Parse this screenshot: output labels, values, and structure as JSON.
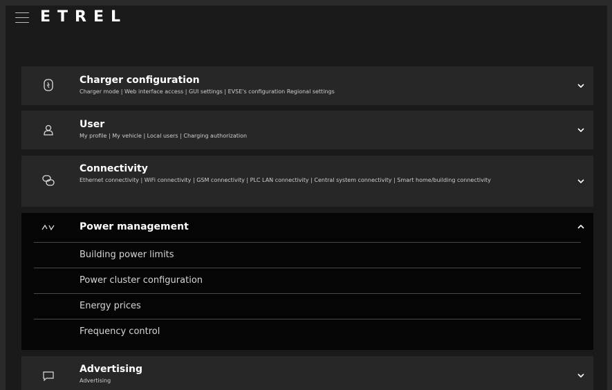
{
  "header": {
    "brand": "ETREL"
  },
  "sections": [
    {
      "title": "Charger configuration",
      "subtitle": "Charger mode | Web interface access | GUI settings | EVSE's configuration Regional settings",
      "icon": "charger-icon",
      "expanded": false
    },
    {
      "title": "User",
      "subtitle": "My profile | My vehicle | Local users | Charging authorization",
      "icon": "user-icon",
      "expanded": false
    },
    {
      "title": "Connectivity",
      "subtitle": "Ethernet connectivity | WiFi connectivity | GSM connectivity | PLC LAN connectivity | Central system connectivity | Smart home/building connectivity",
      "icon": "link-icon",
      "expanded": false
    },
    {
      "title": "Power management",
      "subtitle": "",
      "icon": "power-wave-icon",
      "expanded": true,
      "items": [
        "Building power limits",
        "Power cluster configuration",
        "Energy prices",
        "Frequency control"
      ]
    },
    {
      "title": "Advertising",
      "subtitle": "Advertising",
      "icon": "message-icon",
      "expanded": false
    }
  ]
}
